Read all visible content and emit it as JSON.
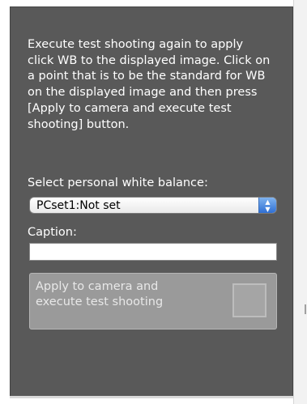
{
  "instructions": "Execute test shooting again to apply\nclick WB to the displayed image. Click on\na point that is to be the standard for WB\non the displayed image and then press\n[Apply to camera and execute test\nshooting] button.",
  "white_balance": {
    "label": "Select personal white balance:",
    "selected": "PCset1:Not set"
  },
  "caption": {
    "label": "Caption:",
    "value": ""
  },
  "apply_button": {
    "label": "Apply to camera and\nexecute test shooting"
  },
  "icons": {
    "select_arrows": "up-down-arrows-icon",
    "apply_button_icon": "camera-apply-icon"
  },
  "colors": {
    "panel_background": "#595959",
    "select_arrow_blue": "#2f6fd4",
    "button_disabled": "#9a9a9a"
  }
}
